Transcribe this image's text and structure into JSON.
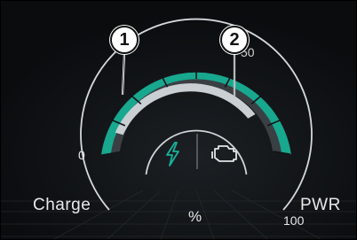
{
  "gauge": {
    "scale_min_label": "0",
    "scale_max_label": "100",
    "scale_partial_label": "50",
    "left_label": "Charge",
    "right_label": "PWR",
    "unit_label": "%",
    "icons": {
      "left": "lightning-bolt-icon",
      "right": "engine-icon"
    }
  },
  "callouts": [
    "1",
    "2"
  ],
  "colors": {
    "background": "#0c0e10",
    "accent": "#17a88f",
    "inner_arc": "#c9cfd3",
    "text": "#e8e8e8"
  }
}
